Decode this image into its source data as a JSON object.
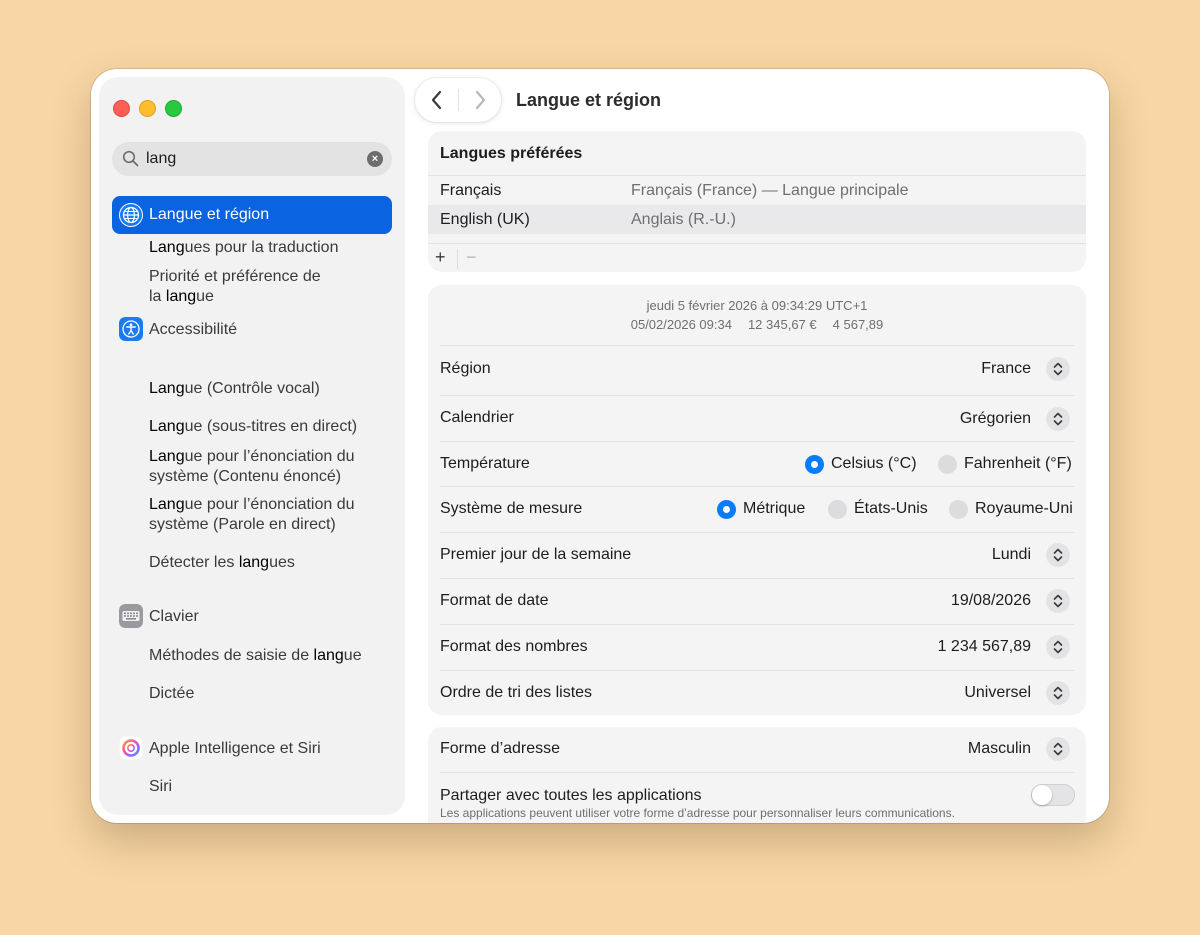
{
  "window": {
    "title": "Langue et région"
  },
  "search": {
    "query": "lang",
    "clear_icon": "xmark-circle-icon"
  },
  "sidebar": {
    "items": [
      {
        "pre": "",
        "hl": "Lang",
        "post": "ue et région",
        "icon": "globe-icon",
        "selected": true
      },
      {
        "pre": "",
        "hl": "Lang",
        "post": "ues pour la traduction"
      },
      {
        "pre1": "Priorité et préférence de",
        "pre2": "la ",
        "hl": "lang",
        "post": "ue"
      },
      {
        "label": "Accessibilité",
        "icon": "accessibility-icon"
      },
      {
        "pre": "",
        "hl": "Lang",
        "post": "ue (Contrôle vocal)"
      },
      {
        "pre": "",
        "hl": "Lang",
        "post": "ue (sous-titres en direct)"
      },
      {
        "hl": "Lang",
        "post1": "ue pour l’énonciation du",
        "line2": "système (Contenu énoncé)"
      },
      {
        "hl": "Lang",
        "post1": "ue pour l’énonciation du",
        "line2": "système (Parole en direct)"
      },
      {
        "pre": "Détecter les ",
        "hl": "lang",
        "post": "ues"
      },
      {
        "label": "Clavier",
        "icon": "keyboard-icon"
      },
      {
        "pre": "Méthodes de saisie de ",
        "hl": "lang",
        "post": "ue"
      },
      {
        "label": "Dictée"
      },
      {
        "label": "Apple Intelligence et Siri",
        "icon": "apple-intelligence-icon"
      },
      {
        "label": "Siri"
      }
    ]
  },
  "languages": {
    "header": "Langues préférées",
    "rows": [
      {
        "name": "Français",
        "desc": "Français (France) — Langue principale"
      },
      {
        "name": "English (UK)",
        "desc": "Anglais (R.-U.)"
      }
    ],
    "add_label": "+",
    "remove_label": "−"
  },
  "preview": {
    "line1": "jeudi 5 février 2026 à 09:34:29 UTC+1",
    "date": "05/02/2026 09:34",
    "currency": "12 345,67 €",
    "number": "4 567,89"
  },
  "settings": {
    "region": {
      "label": "Région",
      "value": "France"
    },
    "calendar": {
      "label": "Calendrier",
      "value": "Grégorien"
    },
    "temperature": {
      "label": "Température",
      "options": [
        "Celsius (°C)",
        "Fahrenheit (°F)"
      ],
      "selected": "Celsius (°C)"
    },
    "measure": {
      "label": "Système de mesure",
      "options": [
        "Métrique",
        "États-Unis",
        "Royaume-Uni"
      ],
      "selected": "Métrique"
    },
    "first_day": {
      "label": "Premier jour de la semaine",
      "value": "Lundi"
    },
    "date_format": {
      "label": "Format de date",
      "value": "19/08/2026"
    },
    "number_format": {
      "label": "Format des nombres",
      "value": "1 234 567,89"
    },
    "sort_order": {
      "label": "Ordre de tri des listes",
      "value": "Universel"
    }
  },
  "address": {
    "form": {
      "label": "Forme d’adresse",
      "value": "Masculin"
    },
    "share": {
      "label": "Partager avec toutes les applications",
      "note": "Les applications peuvent utiliser votre forme d’adresse pour personnaliser leurs communications.",
      "enabled": false
    }
  },
  "colors": {
    "accent": "#0a63e0",
    "radio_on": "#0a7cf8",
    "background": "#f8d6a6"
  }
}
